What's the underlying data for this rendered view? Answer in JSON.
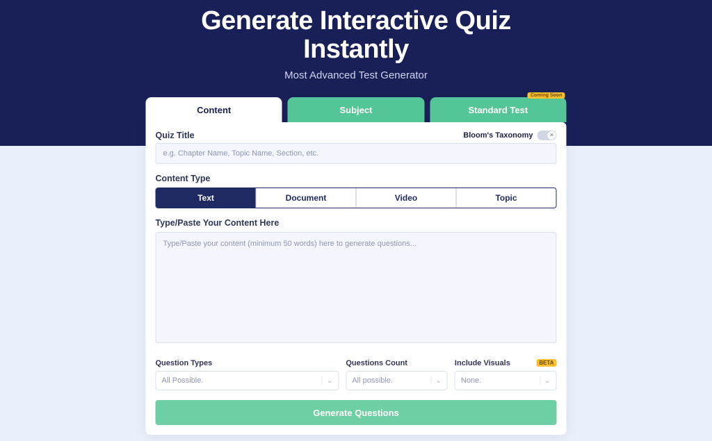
{
  "hero": {
    "title_line1": "Generate Interactive Quiz",
    "title_line2": "Instantly",
    "subtitle": "Most Advanced Test Generator"
  },
  "tabs": {
    "content": "Content",
    "subject": "Subject",
    "standard": "Standard Test",
    "standard_badge": "Coming Soon"
  },
  "form": {
    "quiz_title_label": "Quiz Title",
    "bloom_label": "Bloom's Taxonomy",
    "quiz_title_placeholder": "e.g. Chapter Name, Topic Name, Section, etc.",
    "content_type_label": "Content Type",
    "segments": {
      "text": "Text",
      "document": "Document",
      "video": "Video",
      "topic": "Topic"
    },
    "content_label": "Type/Paste Your Content Here",
    "content_placeholder": "Type/Paste your content (minimum 50 words) here to generate questions...",
    "options": {
      "question_types_label": "Question Types",
      "question_types_value": "All Possible.",
      "questions_count_label": "Questions Count",
      "questions_count_value": "All possible.",
      "include_visuals_label": "Include Visuals",
      "include_visuals_value": "None.",
      "visuals_badge": "BETA"
    },
    "generate_button": "Generate Questions"
  }
}
